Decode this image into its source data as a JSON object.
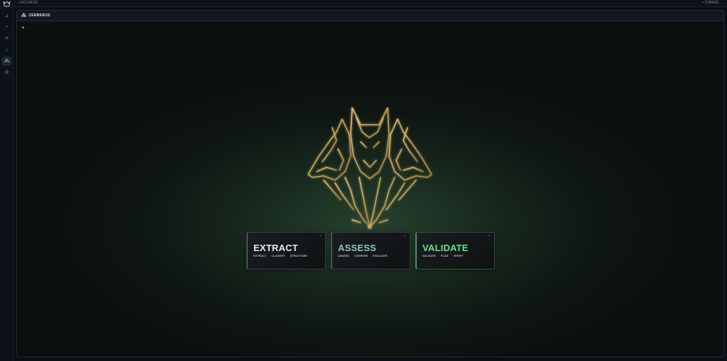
{
  "topbar": {
    "app_name": "+SOURCE",
    "right_label": "• CONFIG"
  },
  "sidebar": {
    "logo_icon": "cerberus-logo-icon",
    "items": [
      {
        "icon": "hook-icon",
        "glyph": "↲",
        "active": false
      },
      {
        "icon": "branch-icon",
        "glyph": "⑂",
        "active": false
      },
      {
        "icon": "crossed-tools-icon",
        "glyph": "✕",
        "active": false
      },
      {
        "icon": "home-icon",
        "glyph": "⌂",
        "active": false
      },
      {
        "icon": "cerberus-icon",
        "glyph": "⁂",
        "active": true
      },
      {
        "icon": "settings-icon",
        "glyph": "⚙",
        "active": false
      }
    ]
  },
  "tab": {
    "label": "CERBERUS",
    "icon": "cerberus-icon"
  },
  "toolbar": {
    "sparkle_glyph": "✷",
    "dot_glyph": "•"
  },
  "colors": {
    "gold": "#c9a65a",
    "assess_teal": "#8cc7b0",
    "validate_green": "#66e48f",
    "background_green": "#26412f"
  },
  "cards": [
    {
      "title": "EXTRACT",
      "subs": [
        "EXTRACT",
        "CLASSIFY",
        "STRUCTURE"
      ]
    },
    {
      "title": "ASSESS",
      "subs": [
        "ASSESS",
        "COMPARE",
        "EVALUATE"
      ]
    },
    {
      "title": "VALIDATE",
      "subs": [
        "VALIDATE",
        "FLAG",
        "VERIFY"
      ]
    }
  ]
}
